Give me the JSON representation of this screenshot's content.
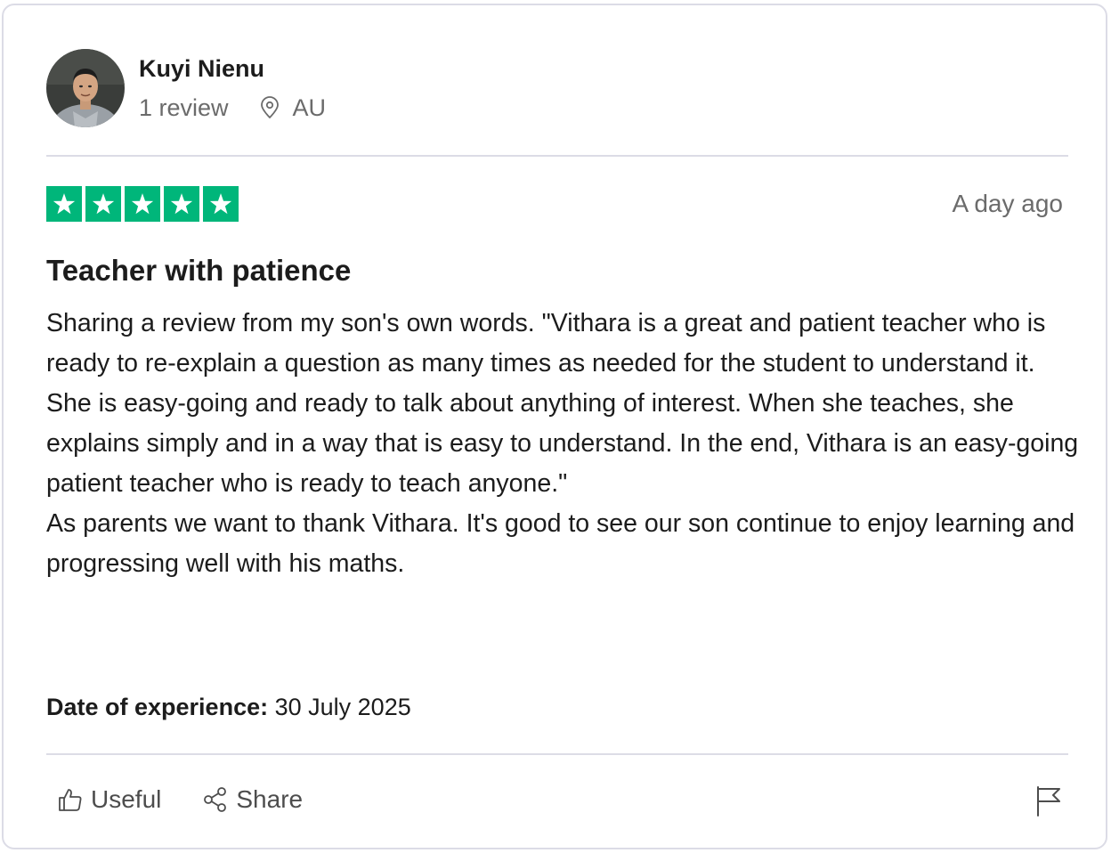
{
  "reviewer": {
    "name": "Kuyi Nienu",
    "review_count": "1 review",
    "country": "AU"
  },
  "review": {
    "rating": 5,
    "rating_max": 5,
    "star_color": "#00b67a",
    "date": "A day ago",
    "title": "Teacher with patience",
    "body_paragraphs": [
      "Sharing a review from my son's own words. \"Vithara is a great and patient teacher who is ready to re-explain a question as many times as needed for the student to understand it. She is easy-going and ready to talk about anything of interest. When she teaches, she explains simply and in a way that is easy to understand. In the end, Vithara is an easy-going patient teacher who is ready to teach anyone.\"",
      "As parents we want to thank Vithara. It's good to see our son continue to enjoy learning and progressing well with his maths."
    ],
    "experience_label": "Date of experience:",
    "experience_date": "30 July 2025"
  },
  "actions": {
    "useful_label": "Useful",
    "share_label": "Share",
    "useful_icon": "thumbs-up-icon",
    "share_icon": "share-icon",
    "flag_icon": "flag-icon"
  }
}
